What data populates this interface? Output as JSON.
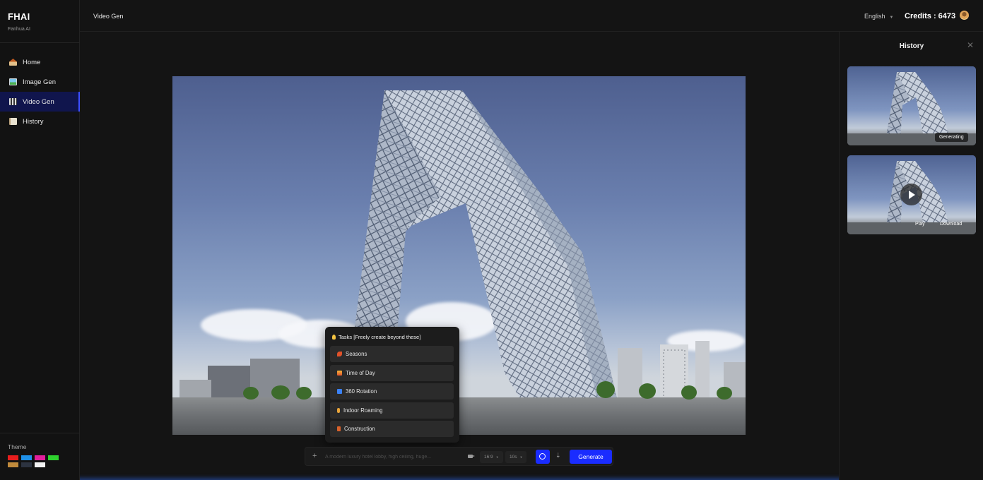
{
  "brand": {
    "name": "FHAI",
    "subtitle": "Fanhua AI"
  },
  "sidebar": {
    "items": [
      {
        "label": "Home",
        "icon": "home-icon"
      },
      {
        "label": "Image Gen",
        "icon": "image-icon"
      },
      {
        "label": "Video Gen",
        "icon": "clapperboard-icon",
        "active": true
      },
      {
        "label": "History",
        "icon": "notebook-icon"
      }
    ],
    "theme_label": "Theme",
    "theme_colors": [
      "#e81d1d",
      "#1e90e8",
      "#e01e9b",
      "#2ed12e",
      "#c08a3c",
      "#2c3340",
      "#f2f2f2"
    ]
  },
  "header": {
    "title": "Video Gen",
    "language": "English",
    "credits": "Credits : 6473"
  },
  "tasks": {
    "title": "Tasks [Freely create beyond these]",
    "items": [
      {
        "label": "Seasons",
        "icon": "maple-leaf-icon",
        "color": "#e0522a"
      },
      {
        "label": "Time of Day",
        "icon": "sunrise-icon",
        "color": "#f08a2e"
      },
      {
        "label": "360 Rotation",
        "icon": "rotation-icon",
        "color": "#3b82f6"
      },
      {
        "label": "Indoor Roaming",
        "icon": "walking-icon",
        "color": "#e8a43a"
      },
      {
        "label": "Construction",
        "icon": "crane-icon",
        "color": "#d9622b"
      }
    ]
  },
  "prompt": {
    "placeholder": "A modern luxury hotel lobby, high ceiling, huge...",
    "aspect_ratio": "16:9",
    "duration": "10s",
    "generate_label": "Generate"
  },
  "history": {
    "title": "History",
    "cards": [
      {
        "status": "Generating"
      },
      {
        "play_label": "Play",
        "download_label": "Download"
      }
    ]
  },
  "colors": {
    "accent": "#1a2cff",
    "active_nav": "#10154d",
    "panel": "#141414"
  }
}
